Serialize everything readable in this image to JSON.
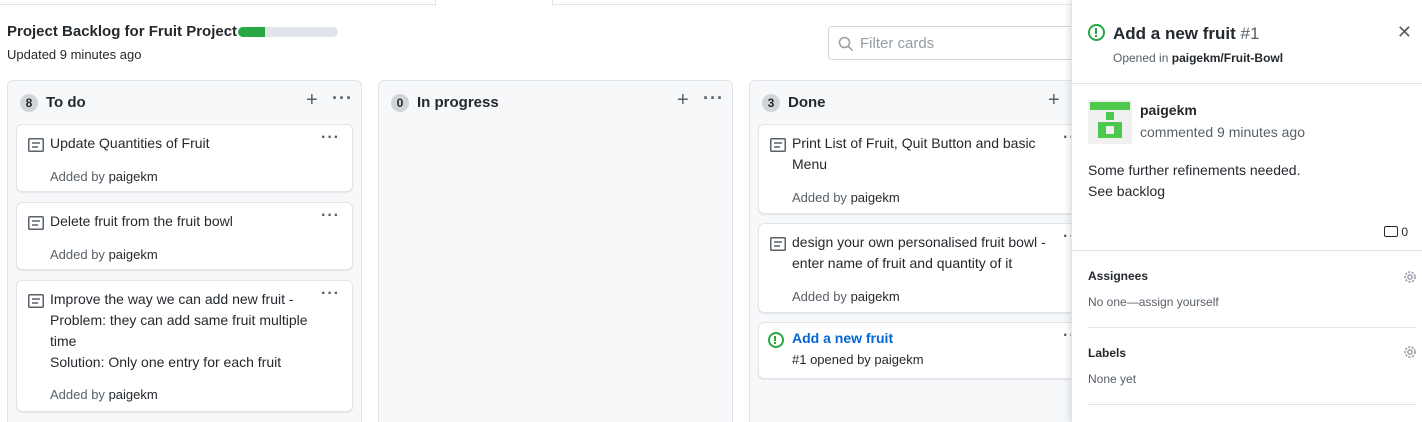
{
  "project": {
    "title": "Project Backlog for Fruit Project",
    "updated": "Updated 9 minutes ago",
    "progress_percent": 27
  },
  "filter": {
    "placeholder": "Filter cards"
  },
  "columns": [
    {
      "count": "8",
      "title": "To do",
      "cards": [
        {
          "text": "Update Quantities of Fruit",
          "added_prefix": "Added by",
          "author": "paigekm"
        },
        {
          "text": "Delete fruit from the fruit bowl",
          "added_prefix": "Added by",
          "author": "paigekm"
        },
        {
          "text": "Improve the way we can add new fruit -\nProblem: they can add same fruit multiple time\nSolution: Only one entry for each fruit",
          "added_prefix": "Added by",
          "author": "paigekm"
        }
      ]
    },
    {
      "count": "0",
      "title": "In progress",
      "cards": []
    },
    {
      "count": "3",
      "title": "Done",
      "cards": [
        {
          "text": "Print List of Fruit, Quit Button and basic Menu",
          "added_prefix": "Added by",
          "author": "paigekm"
        },
        {
          "text": "design your own personalised fruit bowl - enter name of fruit and quantity of it",
          "added_prefix": "Added by",
          "author": "paigekm"
        }
      ],
      "issue": {
        "title": "Add a new fruit",
        "meta": "#1 opened by paigekm"
      }
    }
  ],
  "panel": {
    "title": "Add a new fruit",
    "number": "#1",
    "opened_prefix": "Opened in",
    "repo": "paigekm/Fruit-Bowl",
    "author": "paigekm",
    "commented": "commented 9 minutes ago",
    "comment_line1": "Some further refinements needed.",
    "comment_line2": "See backlog",
    "comment_count": "0",
    "assignees_label": "Assignees",
    "assignees_value": "No one—assign yourself",
    "labels_label": "Labels",
    "labels_value": "None yet"
  },
  "icons": {
    "card": "note-icon",
    "issue": "issue-opened-icon",
    "search": "search-icon",
    "close": "close-icon",
    "gear": "gear-icon",
    "comment": "comment-icon"
  },
  "colors": {
    "accent_green": "#28a745",
    "link_blue": "#0366d6"
  }
}
